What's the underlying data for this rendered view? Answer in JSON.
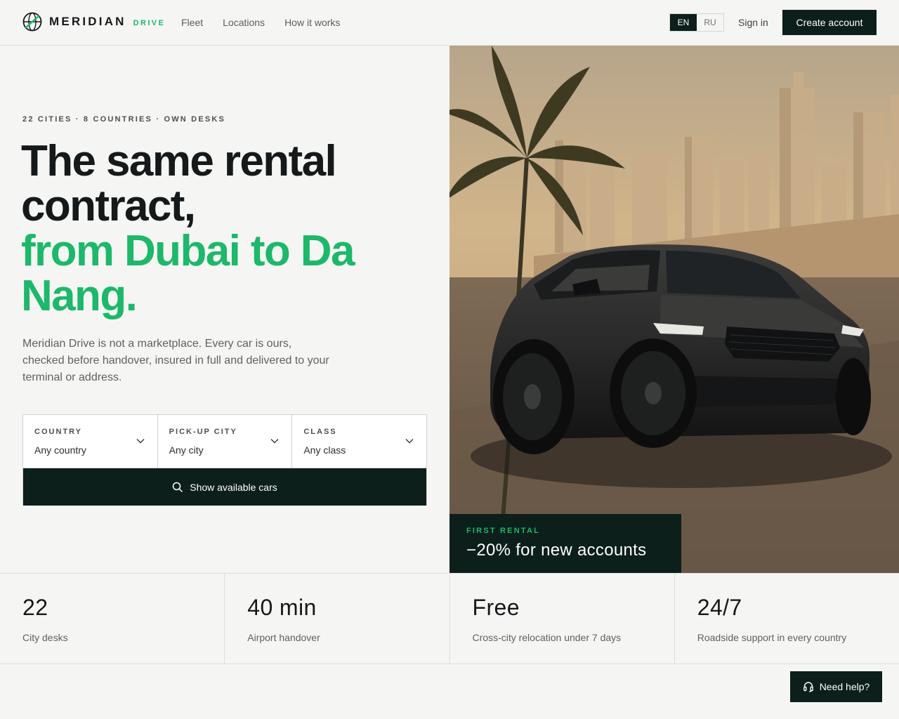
{
  "header": {
    "brand": "MERIDIAN",
    "brand_sub": "DRIVE",
    "nav": [
      "Fleet",
      "Locations",
      "How it works"
    ],
    "languages": [
      "EN",
      "RU"
    ],
    "active_language": "EN",
    "sign_in": "Sign in",
    "create_account": "Create account"
  },
  "hero": {
    "eyebrow": "22 CITIES · 8 COUNTRIES · OWN DESKS",
    "headline_line1": "The same rental contract,",
    "headline_accent": "from Dubai to Da Nang.",
    "lede": "Meridian Drive is not a marketplace. Every car is ours, checked before handover, insured in full and delivered to your terminal or address."
  },
  "search": {
    "fields": [
      {
        "label": "COUNTRY",
        "value": "Any country"
      },
      {
        "label": "PICK-UP CITY",
        "value": "Any city"
      },
      {
        "label": "CLASS",
        "value": "Any class"
      }
    ],
    "button": "Show available cars"
  },
  "promo": {
    "eyebrow": "FIRST RENTAL",
    "title": "−20% for new accounts"
  },
  "stats": [
    {
      "value": "22",
      "label": "City desks"
    },
    {
      "value": "40 min",
      "label": "Airport handover"
    },
    {
      "value": "Free",
      "label": "Cross-city relocation under 7 days"
    },
    {
      "value": "24/7",
      "label": "Roadside support in every country"
    }
  ],
  "help": {
    "label": "Need help?"
  },
  "colors": {
    "accent": "#1db86a",
    "dark": "#0c1f1a",
    "background": "#f5f6f4"
  }
}
